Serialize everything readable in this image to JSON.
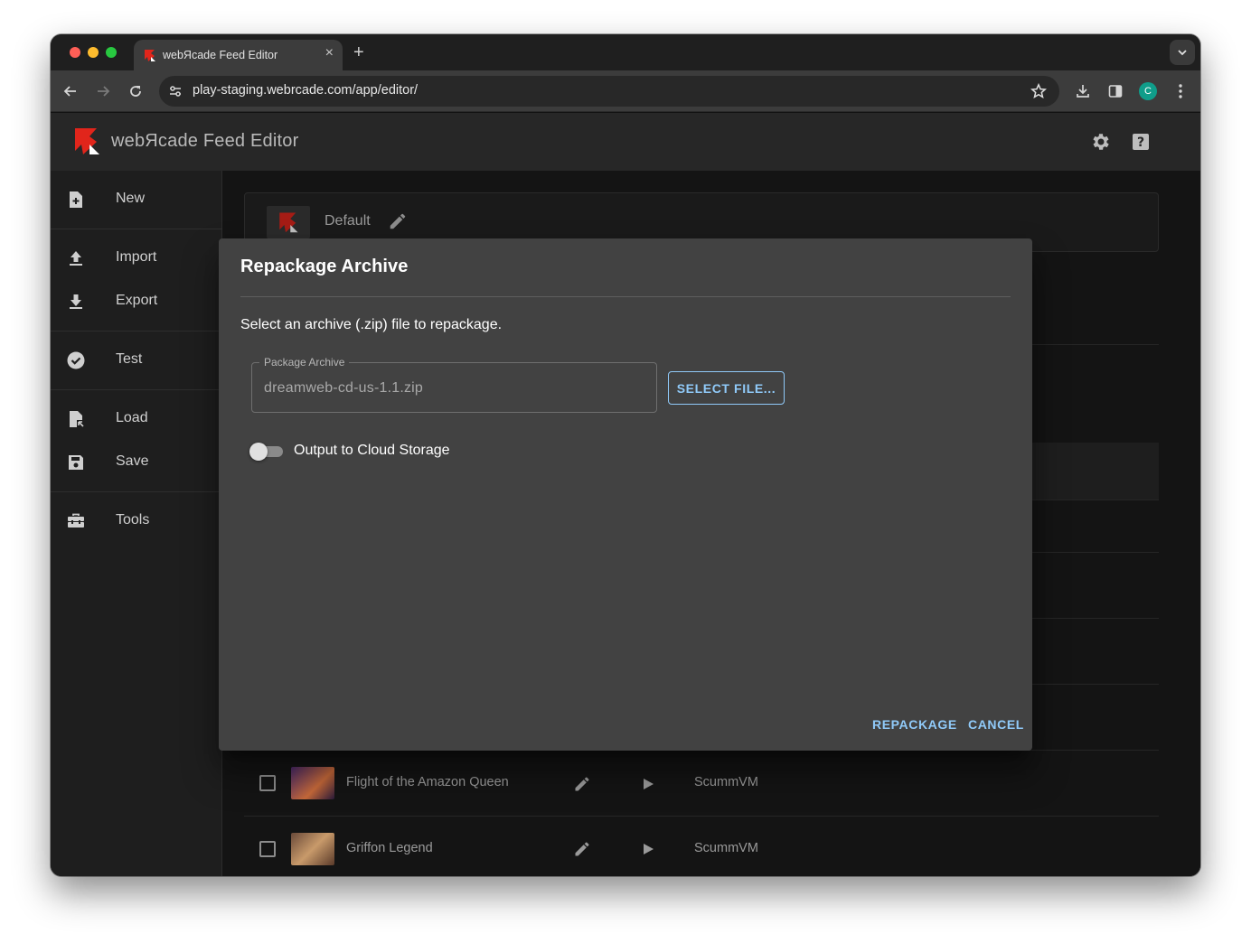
{
  "browser": {
    "tab_title": "webЯcade Feed Editor",
    "tab_close": "×",
    "new_tab": "+",
    "url": "play-staging.webrcade.com/app/editor/",
    "profile_initial": "C"
  },
  "app": {
    "title": "webЯcade Feed Editor"
  },
  "sidebar": {
    "items": [
      {
        "label": "New",
        "icon": "new-file-icon"
      },
      {
        "label": "Import",
        "icon": "upload-icon"
      },
      {
        "label": "Export",
        "icon": "download-icon"
      },
      {
        "label": "Test",
        "icon": "check-circle-icon"
      },
      {
        "label": "Load",
        "icon": "load-file-icon"
      },
      {
        "label": "Save",
        "icon": "save-icon"
      },
      {
        "label": "Tools",
        "icon": "toolbox-icon"
      }
    ]
  },
  "background": {
    "feed_name": "Default",
    "rows": [
      {
        "title": "Flight of the Amazon Queen",
        "type": "ScummVM"
      },
      {
        "title": "Griffon Legend",
        "type": "ScummVM"
      }
    ]
  },
  "dialog": {
    "title": "Repackage Archive",
    "description": "Select an archive (.zip) file to repackage.",
    "field_label": "Package Archive",
    "field_value": "dreamweb-cd-us-1.1.zip",
    "select_button": "SELECT FILE...",
    "toggle_label": "Output to Cloud Storage",
    "toggle_on": false,
    "primary_action": "REPACKAGE",
    "secondary_action": "CANCEL"
  },
  "colors": {
    "accent": "#90caf9",
    "dialog_bg": "#424242",
    "brand_red": "#e1251b"
  }
}
